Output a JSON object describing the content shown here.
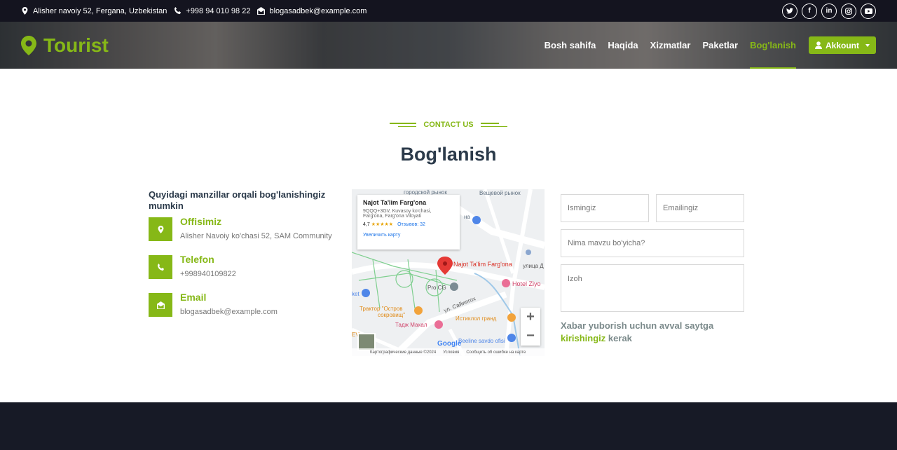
{
  "topbar": {
    "address": "Alisher navoiy 52, Fergana, Uzbekistan",
    "phone": "+998 94 010 98 22",
    "email": "blogasadbek@example.com",
    "socials": [
      "twitter-icon",
      "facebook-icon",
      "linkedin-icon",
      "instagram-icon",
      "youtube-icon"
    ]
  },
  "brand": {
    "name": "Tourist",
    "color": "#86b817"
  },
  "nav": {
    "items": [
      "Bosh sahifa",
      "Haqida",
      "Xizmatlar",
      "Paketlar",
      "Bog'lanish"
    ],
    "active": "Bog'lanish",
    "account_label": "Akkount"
  },
  "section": {
    "eyebrow": "CONTACT US",
    "title": "Bog'lanish"
  },
  "contact": {
    "intro": "Quyidagi manzillar orqali bog'lanishingiz mumkin",
    "office": {
      "title": "Offisimiz",
      "value": "Alisher Navoiy ko'chasi 52, SAM Community"
    },
    "phone": {
      "title": "Telefon",
      "value": "+998940109822"
    },
    "email": {
      "title": "Email",
      "value": "blogasadbek@example.com"
    }
  },
  "map": {
    "place_name": "Najot Ta'lim Farg'ona",
    "address_line1": "9QQQ+3GV, Kuvasoy ko'chasi,",
    "address_line2": "Farg'ona, Farg'ona Viloyati",
    "rating": "4,7",
    "stars": "★★★★★",
    "reviews": "Отзывов: 32",
    "enlarge": "Увеличить карту",
    "labels": {
      "market1": "городской рынок",
      "market2": "Вещевой рынок",
      "pin": "Najot Ta'lim Farg'ona",
      "hotel": "Hotel Ziyo",
      "procg": "Pro CG",
      "street1": "улица Д",
      "street2": "ул. Сайилгох",
      "tractor1": "Трактор \"Остров",
      "tractor2": "сокровищ\"",
      "taj": "Тадж Махал",
      "istiklol": "Истиклол гранд",
      "beeline": "Beeline savdo ofisi",
      "ket": "ket",
      "ev": "EV",
      "ma": "на"
    },
    "zoom_in": "+",
    "zoom_out": "−",
    "google": "Google",
    "footer": {
      "data": "Картографические данные ©2024",
      "terms": "Условия",
      "report": "Сообщить об ошибке на карте"
    }
  },
  "form": {
    "name_placeholder": "Ismingiz",
    "email_placeholder": "Emailingiz",
    "subject_placeholder": "Nima mavzu bo'yicha?",
    "message_placeholder": "Izoh",
    "note_before": "Xabar yuborish uchun avval saytga",
    "note_link": "kirishingiz",
    "note_after": "kerak"
  }
}
